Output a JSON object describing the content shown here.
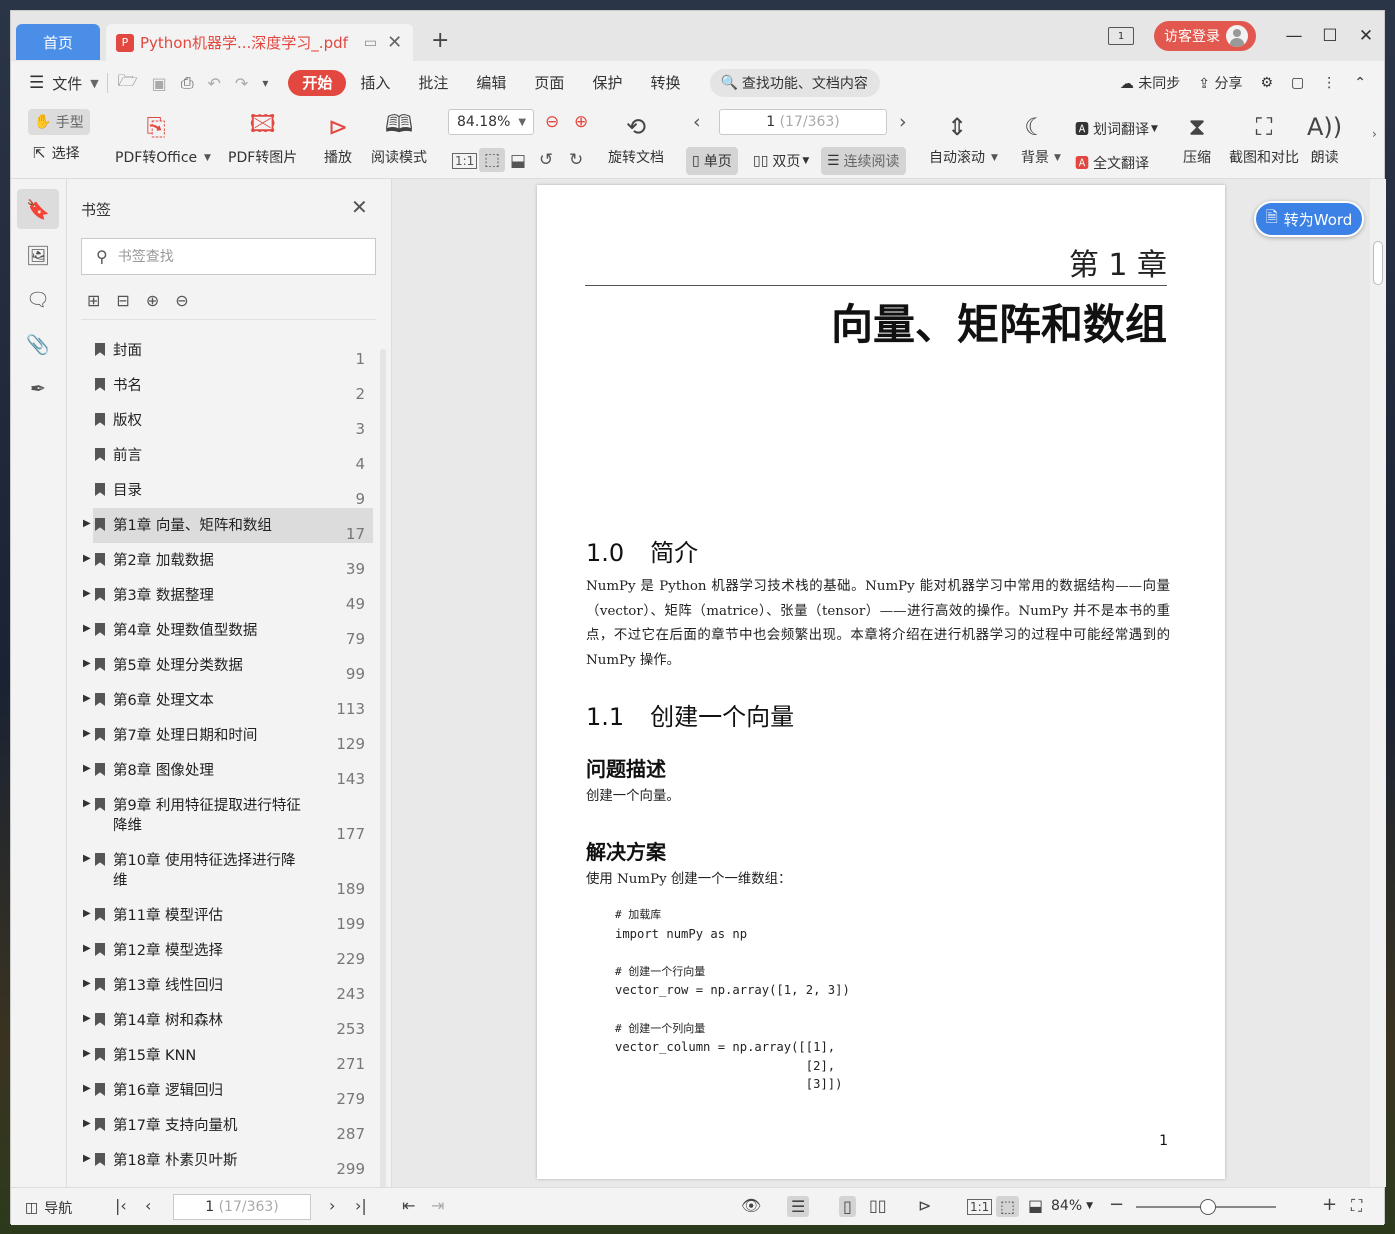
{
  "window": {
    "home_tab": "首页",
    "doc_tab_title": "Python机器学...深度学习_.pdf",
    "new_tab": "+",
    "screen_badge": "1",
    "login_label": "访客登录"
  },
  "menu": {
    "file": "文件",
    "tabs": [
      "开始",
      "插入",
      "批注",
      "编辑",
      "页面",
      "保护",
      "转换"
    ],
    "active_tab": "开始",
    "search_placeholder": "查找功能、文档内容",
    "sync": "未同步",
    "share": "分享"
  },
  "ribbon": {
    "hand": "手型",
    "select": "选择",
    "pdf_to_office": "PDF转Office",
    "pdf_to_image": "PDF转图片",
    "play": "播放",
    "read_mode": "阅读模式",
    "zoom": "84.18%",
    "rotate_doc": "旋转文档",
    "page_current": "1",
    "page_total": "(17/363)",
    "single_page": "单页",
    "double_page": "双页",
    "continuous": "连续阅读",
    "auto_scroll": "自动滚动",
    "background": "背景",
    "word_translate": "划词翻译",
    "full_translate": "全文翻译",
    "compress": "压缩",
    "screenshot_compare": "截图和对比",
    "read_aloud": "朗读"
  },
  "bookmarks": {
    "title": "书签",
    "search_placeholder": "书签查找",
    "items": [
      {
        "label": "封面",
        "page": "1",
        "expandable": false
      },
      {
        "label": "书名",
        "page": "2",
        "expandable": false
      },
      {
        "label": "版权",
        "page": "3",
        "expandable": false
      },
      {
        "label": "前言",
        "page": "4",
        "expandable": false
      },
      {
        "label": "目录",
        "page": "9",
        "expandable": false
      },
      {
        "label": "第1章 向量、矩阵和数组",
        "page": "17",
        "expandable": true,
        "selected": true
      },
      {
        "label": "第2章 加载数据",
        "page": "39",
        "expandable": true
      },
      {
        "label": "第3章 数据整理",
        "page": "49",
        "expandable": true
      },
      {
        "label": "第4章 处理数值型数据",
        "page": "79",
        "expandable": true
      },
      {
        "label": "第5章 处理分类数据",
        "page": "99",
        "expandable": true
      },
      {
        "label": "第6章 处理文本",
        "page": "113",
        "expandable": true
      },
      {
        "label": "第7章 处理日期和时间",
        "page": "129",
        "expandable": true
      },
      {
        "label": "第8章 图像处理",
        "page": "143",
        "expandable": true
      },
      {
        "label": "第9章 利用特征提取进行特征降维",
        "page": "177",
        "expandable": true,
        "tall": true
      },
      {
        "label": "第10章 使用特征选择进行降维",
        "page": "189",
        "expandable": true,
        "tall": true
      },
      {
        "label": "第11章 模型评估",
        "page": "199",
        "expandable": true
      },
      {
        "label": "第12章 模型选择",
        "page": "229",
        "expandable": true
      },
      {
        "label": "第13章 线性回归",
        "page": "243",
        "expandable": true
      },
      {
        "label": "第14章 树和森林",
        "page": "253",
        "expandable": true
      },
      {
        "label": "第15章 KNN",
        "page": "271",
        "expandable": true
      },
      {
        "label": "第16章 逻辑回归",
        "page": "279",
        "expandable": true
      },
      {
        "label": "第17章 支持向量机",
        "page": "287",
        "expandable": true
      },
      {
        "label": "第18章 朴素贝叶斯",
        "page": "299",
        "expandable": true
      }
    ]
  },
  "document": {
    "chapter_number": "第 1 章",
    "chapter_title": "向量、矩阵和数组",
    "s10_num": "1.0",
    "s10_title": "简介",
    "intro": "NumPy 是 Python 机器学习技术栈的基础。NumPy 能对机器学习中常用的数据结构——向量（vector）、矩阵（matrice）、张量（tensor）——进行高效的操作。NumPy 并不是本书的重点，不过它在后面的章节中也会频繁出现。本章将介绍在进行机器学习的过程中可能经常遇到的 NumPy 操作。",
    "s11_num": "1.1",
    "s11_title": "创建一个向量",
    "problem_heading": "问题描述",
    "problem_text": "创建一个向量。",
    "solution_heading": "解决方案",
    "solution_text": "使用 NumPy 创建一个一维数组：",
    "code_c1": "# 加载库",
    "code_l1": "import numPy as np",
    "code_c2": "# 创建一个行向量",
    "code_l2": "vector_row = np.array([1, 2, 3])",
    "code_c3": "# 创建一个列向量",
    "code_l3": "vector_column = np.array([[1],",
    "code_l4": "                          [2],",
    "code_l5": "                          [3]])",
    "page_number": "1",
    "to_word": "转为Word"
  },
  "statusbar": {
    "nav": "导航",
    "page_current": "1",
    "page_total": "(17/363)",
    "zoom": "84%"
  }
}
